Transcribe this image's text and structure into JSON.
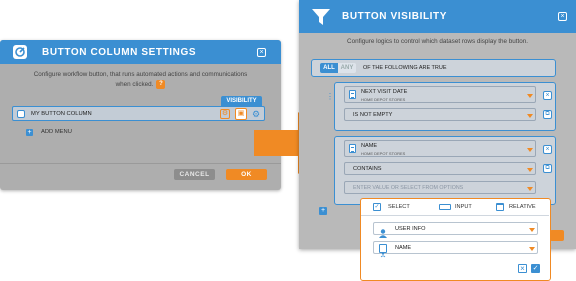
{
  "left_dialog": {
    "title": "BUTTON COLUMN SETTINGS",
    "description_line1": "Configure workflow button, that runs automated actions and communications",
    "description_line2": "when clicked.",
    "help": "?",
    "visibility_tag": "VISIBILITY",
    "row_label": "MY BUTTON COLUMN",
    "add_menu": "ADD MENU",
    "cancel_label": "CANCEL",
    "ok_label": "OK"
  },
  "right_dialog": {
    "title": "BUTTON VISIBILITY",
    "description": "Configure logics to control which dataset rows display the button.",
    "all_label": "ALL",
    "any_label": "ANY",
    "following_text": "OF THE FOLLOWING ARE TRUE",
    "condition1": {
      "field": "NEXT VISIT DATE",
      "source": "HOME DEPOT STORES",
      "operator": "IS NOT EMPTY"
    },
    "condition2": {
      "field": "NAME",
      "source": "HOME DEPOT STORES",
      "operator": "CONTAINS",
      "value_placeholder": "ENTER VALUE OR SELECT FROM OPTIONS"
    }
  },
  "popup": {
    "tabs": [
      {
        "label": "SELECT"
      },
      {
        "label": "INPUT"
      },
      {
        "label": "RELATIVE"
      }
    ],
    "field1": "USER INFO",
    "field2": "NAME"
  },
  "colors": {
    "accent_blue": "#3b8fd2",
    "accent_orange": "#f08a24",
    "overlay_gray": "#aeaeae"
  }
}
